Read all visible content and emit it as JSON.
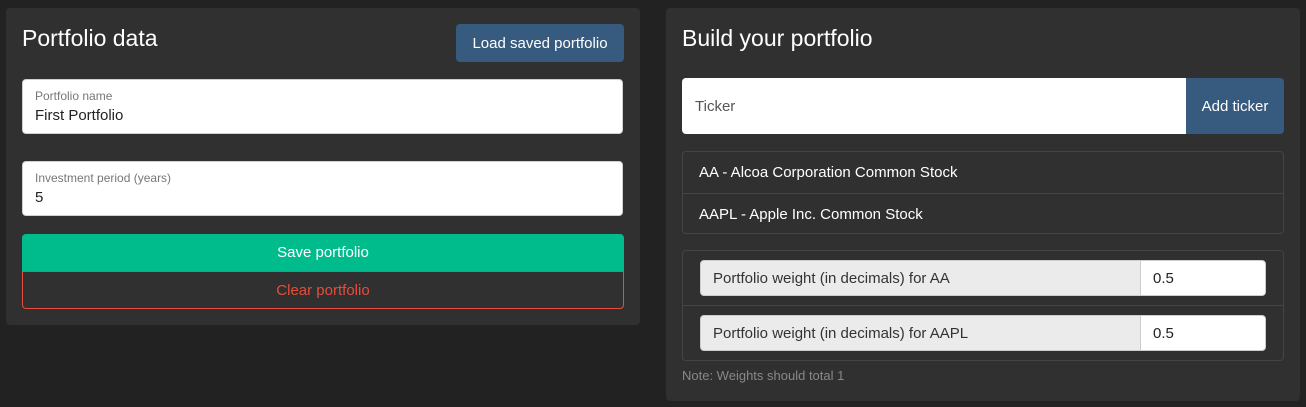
{
  "portfolio_data": {
    "title": "Portfolio data",
    "load_button": "Load saved portfolio",
    "name_field": {
      "label": "Portfolio name",
      "value": "First Portfolio"
    },
    "period_field": {
      "label": "Investment period (years)",
      "value": "5"
    },
    "save_button": "Save portfolio",
    "clear_button": "Clear portfolio"
  },
  "build": {
    "title": "Build your portfolio",
    "ticker_placeholder": "Ticker",
    "add_button": "Add ticker",
    "tickers": [
      "AA - Alcoa Corporation Common Stock",
      "AAPL - Apple Inc. Common Stock"
    ],
    "weights": [
      {
        "label": "Portfolio weight (in decimals) for AA",
        "value": "0.5"
      },
      {
        "label": "Portfolio weight (in decimals) for AAPL",
        "value": "0.5"
      }
    ],
    "note": "Note: Weights should total 1"
  },
  "colors": {
    "background": "#222222",
    "panel": "#303030",
    "primary": "#375a7f",
    "success": "#00bc8c",
    "danger": "#e74c3c"
  }
}
